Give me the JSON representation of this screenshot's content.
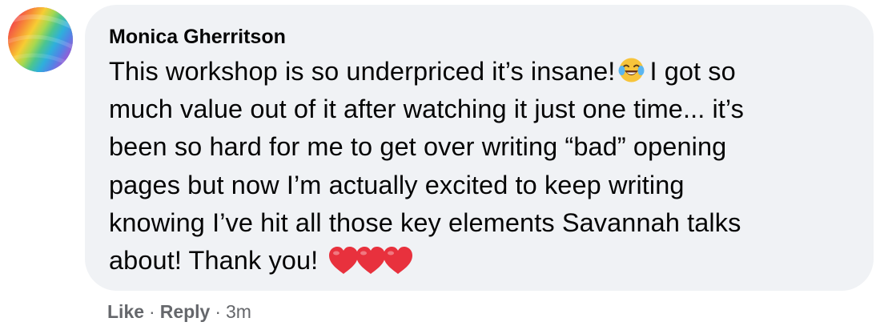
{
  "comment": {
    "author": "Monica Gherritson",
    "text_lines": [
      "This workshop is so underpriced it’s insane!",
      "I got so",
      "much value out of it after watching it just one time... it’s",
      "been so hard for me to get over writing “bad” opening",
      "pages but now I’m actually excited to keep writing",
      "knowing I’ve hit all those key elements Savannah talks",
      "about! Thank you!"
    ],
    "emojis": {
      "inline": "laughing-crying-emoji",
      "trailing": [
        "red-heart-emoji",
        "red-heart-emoji",
        "red-heart-emoji"
      ]
    },
    "actions": {
      "like_label": "Like",
      "reply_label": "Reply",
      "separator": "·",
      "timestamp": "3m"
    }
  },
  "colors": {
    "bubble_bg": "#f0f2f5",
    "text": "#050505",
    "meta_text": "#65676b",
    "heart": "#e8313d"
  }
}
